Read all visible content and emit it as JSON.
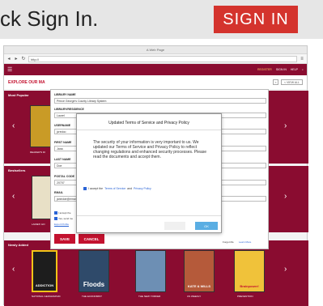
{
  "callout": {
    "text": "ck Sign In.",
    "button": "SIGN IN"
  },
  "browser": {
    "title": "A Web Page",
    "url": "http://"
  },
  "header": {
    "register": "REGISTER",
    "signin": "SIGN IN",
    "help": "HELP"
  },
  "explore": {
    "title": "EXPLORE OUR MA",
    "view_all": "< VIEW ALL"
  },
  "sections": {
    "popular": "Most Popular",
    "bestsellers": "Bestsellers",
    "newly_added": "Newly Added"
  },
  "form": {
    "library_name_label": "LIBRARY NAME",
    "library_name_value": "Prince George's County Library System",
    "library_branch_label": "LIBRARY/RESIDENCE",
    "library_branch_value": "Laurel",
    "username_label": "USERNAME",
    "username_value": "jcredoo",
    "first_name_label": "FIRST NAME",
    "first_name_value": "Jana",
    "last_name_label": "LAST NAME",
    "last_name_value": "Doe",
    "postal_code_label": "POSTAL CODE",
    "postal_code_value": "20707",
    "email_label": "EMAIL",
    "email_value": "janedoe@emai",
    "check1": "I accept the",
    "check2": "Yes, send me",
    "export_profile": "Export Profile",
    "save": "SAVE",
    "cancel": "CANCEL",
    "change_password": "CHANGE PASSWORD",
    "forgot": "Forgot Me",
    "learn_more": "Learn More"
  },
  "modal": {
    "title": "Updated Terms of Service and Privacy Policy",
    "body": "The security of your information is very important to us. We updated our Terms of Service and Privacy Policy to reflect changing regulations and enhanced security processes. Please read the documents and accept them.",
    "accept_prefix": "I accept the",
    "terms_link": "Terms of Service",
    "and": "and",
    "privacy_link": "Privacy Policy",
    "ok": "OK"
  },
  "books": {
    "popular_label1": "READER'S DI",
    "bestsellers_label1": "LADIES' HO",
    "new_labels": [
      "NATIONAL GEOGRAPHIC",
      "THE ECONOMIST",
      "THE NEW YORKER",
      "US WEEKLY",
      "PREVENTION"
    ],
    "new_titles": [
      "ADDICTION",
      "Floods",
      "",
      "KATE & WILLS",
      "Brainpower!"
    ]
  },
  "colors": {
    "maroon": "#8a0c30",
    "red": "#c3122f",
    "blue": "#2a64d6",
    "ok_blue": "#5aaee3"
  }
}
